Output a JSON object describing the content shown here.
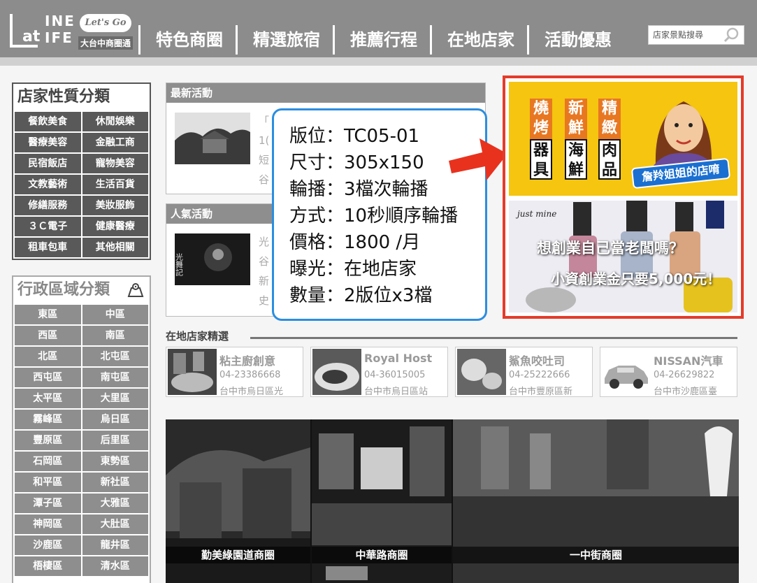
{
  "brand": {
    "logo_l": "L",
    "logo_at": "at",
    "logo_ine": "INE",
    "logo_ife": "IFE",
    "lets_go": "Let's Go",
    "tagline": "大台中商圈通"
  },
  "nav": [
    "特色商圈",
    "精選旅宿",
    "推薦行程",
    "在地店家",
    "活動優惠"
  ],
  "search": {
    "placeholder": "店家景點搜尋"
  },
  "category": {
    "title": "店家性質分類",
    "items": [
      "餐飲美食",
      "休閒娛樂",
      "醫療美容",
      "金融工商",
      "民宿飯店",
      "寵物美容",
      "文教藝術",
      "生活百貨",
      "修繕服務",
      "美妝服飾",
      "３Ｃ電子",
      "健康醫療",
      "租車包車",
      "其他相關"
    ]
  },
  "district": {
    "title": "行政區域分類",
    "items": [
      "東區",
      "中區",
      "西區",
      "南區",
      "北區",
      "北屯區",
      "西屯區",
      "南屯區",
      "太平區",
      "大里區",
      "霧峰區",
      "烏日區",
      "豐原區",
      "后里區",
      "石岡區",
      "東勢區",
      "和平區",
      "新社區",
      "潭子區",
      "大雅區",
      "神岡區",
      "大肚區",
      "沙鹿區",
      "龍井區",
      "梧棲區",
      "清水區"
    ]
  },
  "latest": {
    "title": "最新活動",
    "lines": [
      "「",
      "1(",
      "短",
      "谷"
    ]
  },
  "popular": {
    "title": "人氣活動",
    "lines": [
      "光",
      "谷",
      "新",
      "史"
    ],
    "img_text": "光舞記"
  },
  "callout": {
    "lines": [
      "版位：TC05-01",
      "尺寸：305x150",
      "輪播：3檔次輪播",
      "方式：10秒順序輪播",
      "價格：1800 /月",
      "曝光：在地店家",
      "數量：2版位x3檔"
    ]
  },
  "ad1": {
    "col1_top": "燒烤",
    "col1_bot": "器具",
    "col2_top": "新鮮",
    "col2_bot": "海鮮",
    "col3_top": "精緻",
    "col3_bot": "肉品",
    "badge": "詹羚姐姐的店唷"
  },
  "ad2": {
    "brand": "just mine",
    "line1": "想創業自己當老闆嗎？",
    "line2": "小資創業金只要5,000元！"
  },
  "local": {
    "title": "在地店家精選",
    "shops": [
      {
        "name": "粘主廚創意",
        "tel": "04-23386668",
        "addr": "台中市烏日區光"
      },
      {
        "name": "Royal Host",
        "tel": "04-36015005",
        "addr": "台中市烏日區站"
      },
      {
        "name": "鯊魚咬吐司",
        "tel": "04-25222666",
        "addr": "台中市豐原區新"
      },
      {
        "name": "NISSAN汽車",
        "tel": "04-26629822",
        "addr": "台中市沙鹿區臺"
      }
    ]
  },
  "circles": [
    "勤美綠園道商圈",
    "中華路商圈",
    "一中街商圈"
  ]
}
